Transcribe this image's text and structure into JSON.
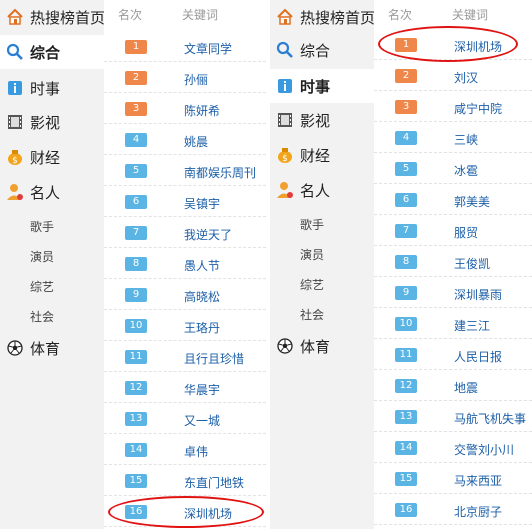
{
  "sidebar_left": {
    "home": "热搜榜首页",
    "composite": "综合",
    "news": "时事",
    "video": "影视",
    "finance": "财经",
    "celebrity": "名人",
    "sub": [
      "歌手",
      "演员",
      "综艺",
      "社会"
    ],
    "sports": "体育"
  },
  "sidebar_right": {
    "home": "热搜榜首页",
    "composite": "综合",
    "news": "时事",
    "video": "影视",
    "finance": "财经",
    "celebrity": "名人",
    "sub": [
      "歌手",
      "演员",
      "综艺",
      "社会"
    ],
    "sports": "体育"
  },
  "list_header": {
    "rank": "名次",
    "keyword": "关键词"
  },
  "left_list": [
    {
      "rank": "1",
      "kw": "文章同学"
    },
    {
      "rank": "2",
      "kw": "孙俪"
    },
    {
      "rank": "3",
      "kw": "陈妍希"
    },
    {
      "rank": "4",
      "kw": "姚晨"
    },
    {
      "rank": "5",
      "kw": "南都娱乐周刊"
    },
    {
      "rank": "6",
      "kw": "吴镇宇"
    },
    {
      "rank": "7",
      "kw": "我逆天了"
    },
    {
      "rank": "8",
      "kw": "愚人节"
    },
    {
      "rank": "9",
      "kw": "高晓松"
    },
    {
      "rank": "10",
      "kw": "王珞丹"
    },
    {
      "rank": "11",
      "kw": "且行且珍惜"
    },
    {
      "rank": "12",
      "kw": "华晨宇"
    },
    {
      "rank": "13",
      "kw": "又一城"
    },
    {
      "rank": "14",
      "kw": "卓伟"
    },
    {
      "rank": "15",
      "kw": "东直门地铁"
    },
    {
      "rank": "16",
      "kw": "深圳机场"
    }
  ],
  "right_list": [
    {
      "rank": "1",
      "kw": "深圳机场"
    },
    {
      "rank": "2",
      "kw": "刘汉"
    },
    {
      "rank": "3",
      "kw": "咸宁中院"
    },
    {
      "rank": "4",
      "kw": "三峡"
    },
    {
      "rank": "5",
      "kw": "冰雹"
    },
    {
      "rank": "6",
      "kw": "郭美美"
    },
    {
      "rank": "7",
      "kw": "服贸"
    },
    {
      "rank": "8",
      "kw": "王俊凯"
    },
    {
      "rank": "9",
      "kw": "深圳暴雨"
    },
    {
      "rank": "10",
      "kw": "建三江"
    },
    {
      "rank": "11",
      "kw": "人民日报"
    },
    {
      "rank": "12",
      "kw": "地震"
    },
    {
      "rank": "13",
      "kw": "马航飞机失事"
    },
    {
      "rank": "14",
      "kw": "交警刘小川"
    },
    {
      "rank": "15",
      "kw": "马来西亚"
    },
    {
      "rank": "16",
      "kw": "北京厨子"
    }
  ],
  "colors": {
    "top_badge": "#f0874a",
    "rest_badge": "#5ab4e4",
    "keyword": "#1c5fa8",
    "highlight_circle": "#e01212"
  },
  "icons": {
    "home": "house-icon",
    "composite": "search-icon",
    "news": "info-icon",
    "video": "film-icon",
    "finance": "coin-bag-icon",
    "celebrity": "person-icon",
    "sports": "soccer-ball-icon"
  }
}
